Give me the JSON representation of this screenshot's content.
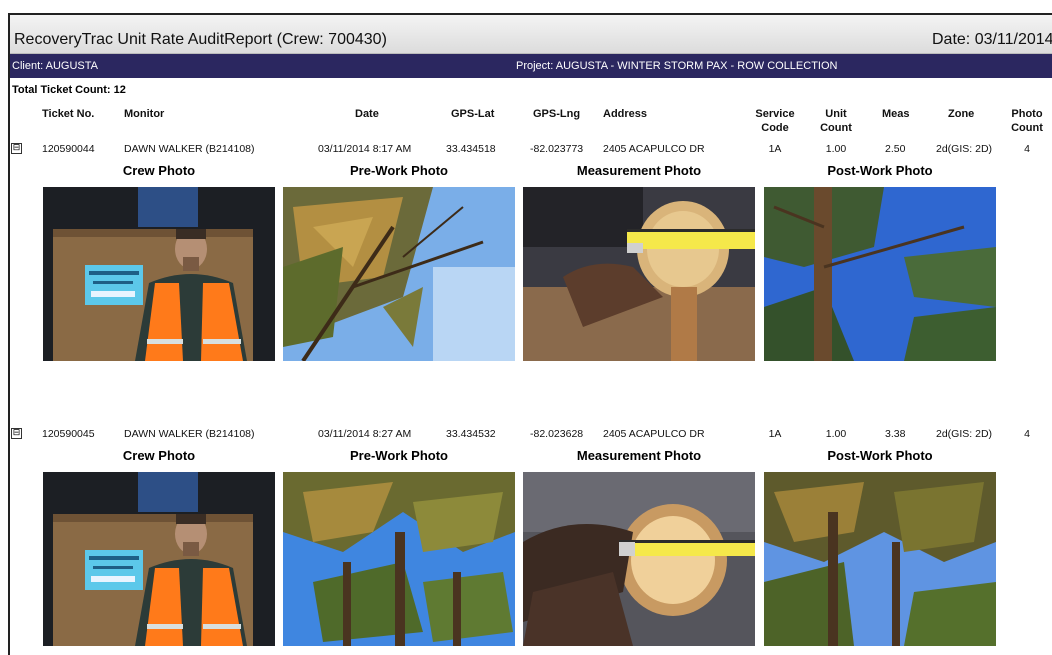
{
  "report": {
    "title": "RecoveryTrac Unit Rate AuditReport (Crew: 700430)",
    "date": "Date: 03/11/2014",
    "client": "Client: AUGUSTA",
    "project": "Project: AUGUSTA - WINTER STORM PAX - ROW COLLECTION",
    "total": "Total Ticket Count: 12"
  },
  "columns": {
    "ticket": "Ticket No.",
    "monitor": "Monitor",
    "date": "Date",
    "lat": "GPS-Lat",
    "lng": "GPS-Lng",
    "address": "Address",
    "service_1": "Service",
    "service_2": "Code",
    "unit_1": "Unit",
    "unit_2": "Count",
    "meas": "Meas",
    "zone": "Zone",
    "photo_1": "Photo",
    "photo_2": "Count"
  },
  "expander_glyph": "⊟",
  "photo_labels": {
    "crew": "Crew Photo",
    "pre": "Pre-Work Photo",
    "measurement": "Measurement Photo",
    "post": "Post-Work Photo"
  },
  "tickets": [
    {
      "ticket": "120590044",
      "monitor": "DAWN WALKER (B214108)",
      "date": "03/11/2014 8:17 AM",
      "lat": "33.434518",
      "lng": "-82.023773",
      "address": "2405 ACAPULCO DR",
      "service": "1A",
      "unit": "1.00",
      "meas": "2.50",
      "zone": "2d(GIS: 2D)",
      "photo_count": "4"
    },
    {
      "ticket": "120590045",
      "monitor": "DAWN WALKER (B214108)",
      "date": "03/11/2014 8:27 AM",
      "lat": "33.434532",
      "lng": "-82.023628",
      "address": "2405 ACAPULCO DR",
      "service": "1A",
      "unit": "1.00",
      "meas": "3.38",
      "zone": "2d(GIS: 2D)",
      "photo_count": "4"
    }
  ]
}
